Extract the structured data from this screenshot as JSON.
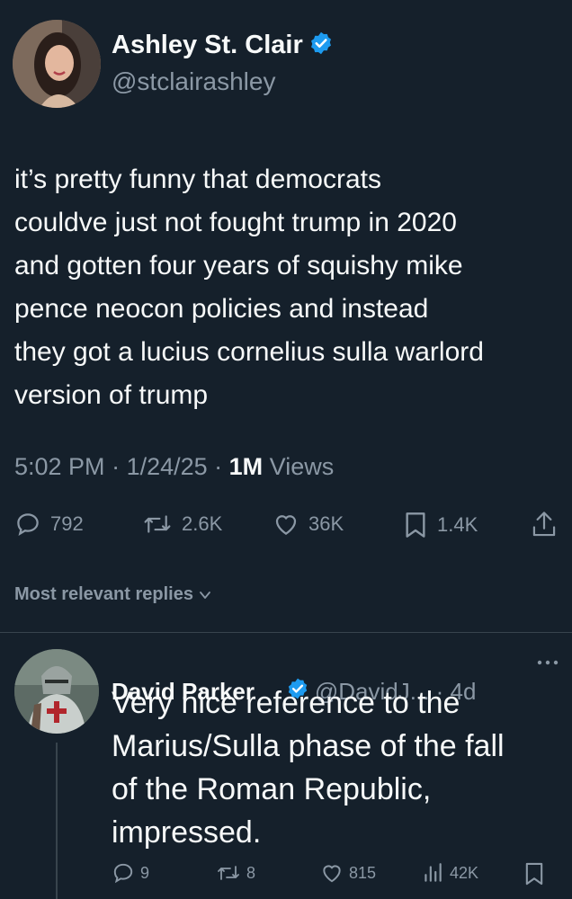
{
  "tweet": {
    "author_name": "Ashley St. Clair",
    "handle": "@stclairashley",
    "text_lines": [
      "it’s pretty funny that democrats",
      "couldve just not fought trump in 2020",
      "and gotten four years of squishy mike",
      "pence neocon policies and instead",
      "they got a lucius cornelius sulla warlord",
      "version of trump"
    ],
    "time": "5:02 PM",
    "sep1": " · ",
    "date": "1/24/25",
    "sep2": " · ",
    "views_count": "1M",
    "views_label": " Views",
    "replies": "792",
    "reposts": "2.6K",
    "likes": "36K",
    "bookmarks": "1.4K"
  },
  "sort": {
    "label": "Most relevant replies"
  },
  "reply": {
    "author_name": "David Parker",
    "handle": "@DavidJ...",
    "sep": " · ",
    "age": "4d",
    "text_lines": [
      "Very nice reference to the",
      "Marius/Sulla phase of the fall",
      "of the Roman Republic,",
      "impressed."
    ],
    "replies": "9",
    "reposts": "8",
    "likes": "815",
    "views": "42K"
  },
  "colors": {
    "background": "#15202b",
    "text": "#f7f9f9",
    "muted": "#8b98a5",
    "verified": "#1d9bf0",
    "divider": "#38444d"
  },
  "icons": {
    "verified": "verified-badge-icon",
    "reply": "reply-icon",
    "repost": "repost-icon",
    "like": "heart-icon",
    "bookmark": "bookmark-icon",
    "share": "share-icon",
    "views": "views-icon",
    "more": "more-icon",
    "chevron": "chevron-down-icon"
  }
}
